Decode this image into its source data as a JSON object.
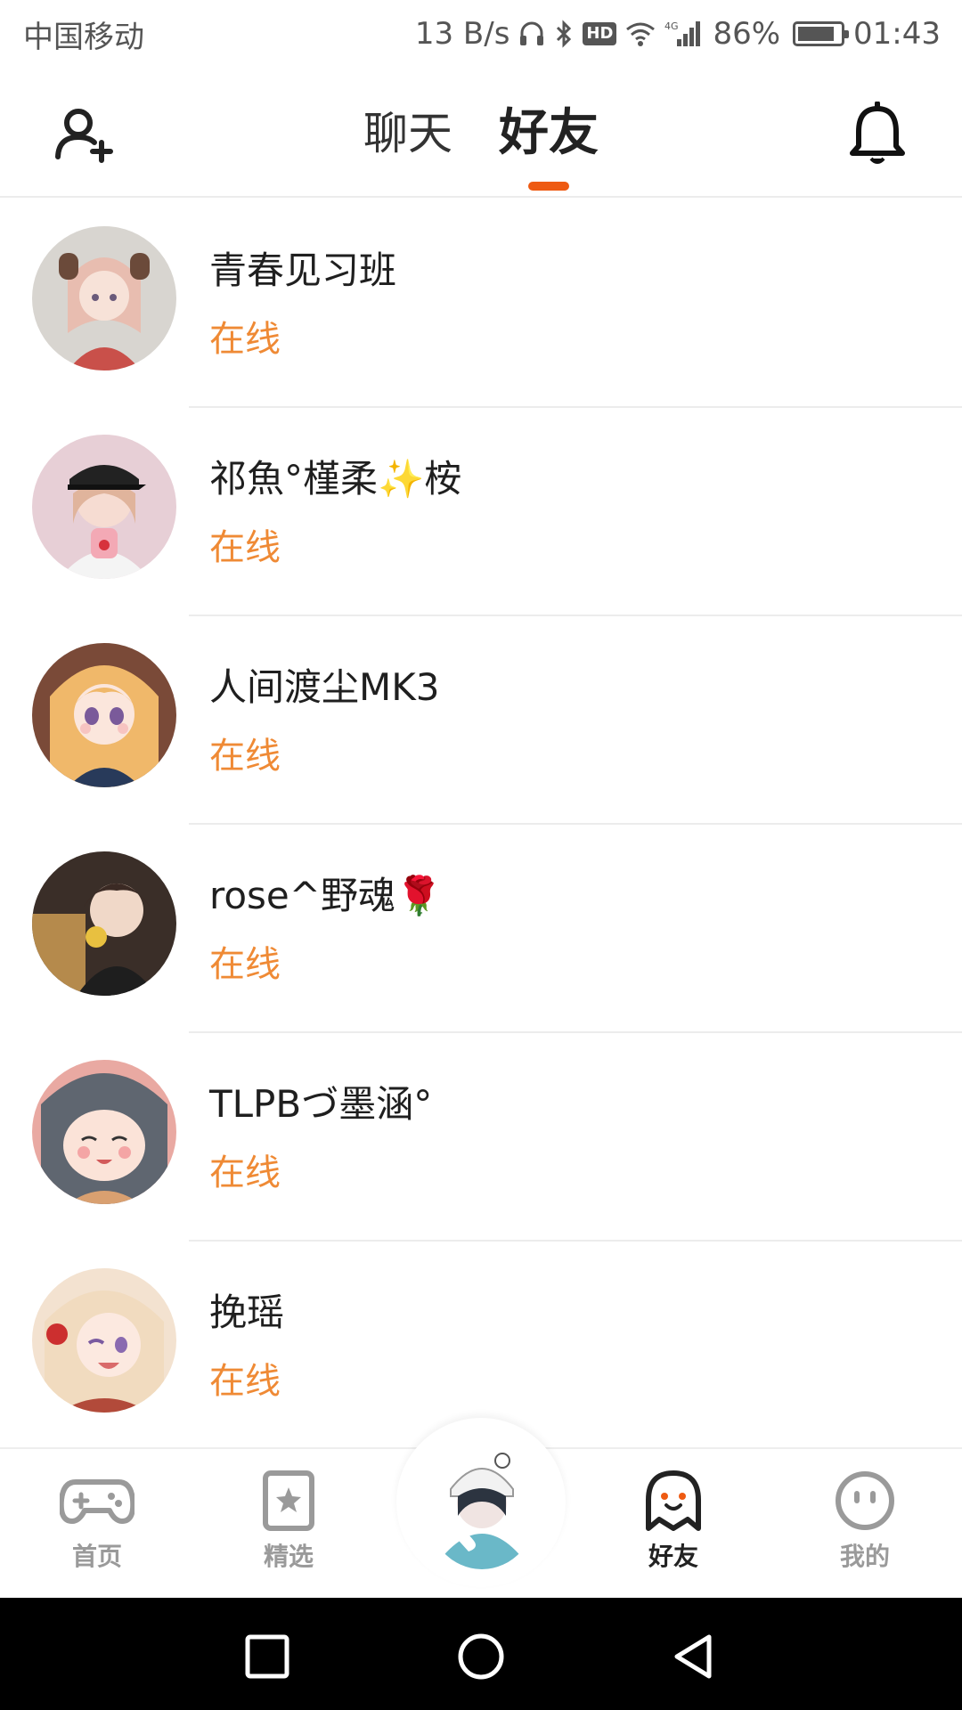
{
  "status_bar": {
    "carrier": "中国移动",
    "net_speed": "13 B/s",
    "hd": "HD",
    "network": "4G",
    "battery_percent": "86%",
    "battery_level": 0.86,
    "time": "01:43"
  },
  "header": {
    "tabs": [
      {
        "label": "聊天",
        "active": false
      },
      {
        "label": "好友",
        "active": true
      }
    ],
    "left_icon": "add-friend-icon",
    "right_icon": "bell-icon",
    "accent_color": "#ee5a12"
  },
  "friends": [
    {
      "name": "青春见习班",
      "status": "在线"
    },
    {
      "name": "祁魚°槿柔✨桉",
      "status": "在线"
    },
    {
      "name": "人间渡尘MK3",
      "status": "在线"
    },
    {
      "name": "rose^野魂🌹",
      "status": "在线"
    },
    {
      "name": "TLPBづ墨涵°",
      "status": "在线"
    },
    {
      "name": "挽瑶",
      "status": "在线"
    }
  ],
  "status_color": "#ef8a35",
  "bottom_nav": {
    "items": [
      {
        "label": "首页",
        "icon": "gamepad-icon",
        "active": false
      },
      {
        "label": "精选",
        "icon": "star-bookmark-icon",
        "active": false
      },
      {
        "label": "",
        "icon": "center-avatar",
        "active": false
      },
      {
        "label": "好友",
        "icon": "ghost-icon",
        "active": true
      },
      {
        "label": "我的",
        "icon": "smiley-icon",
        "active": false
      }
    ]
  }
}
